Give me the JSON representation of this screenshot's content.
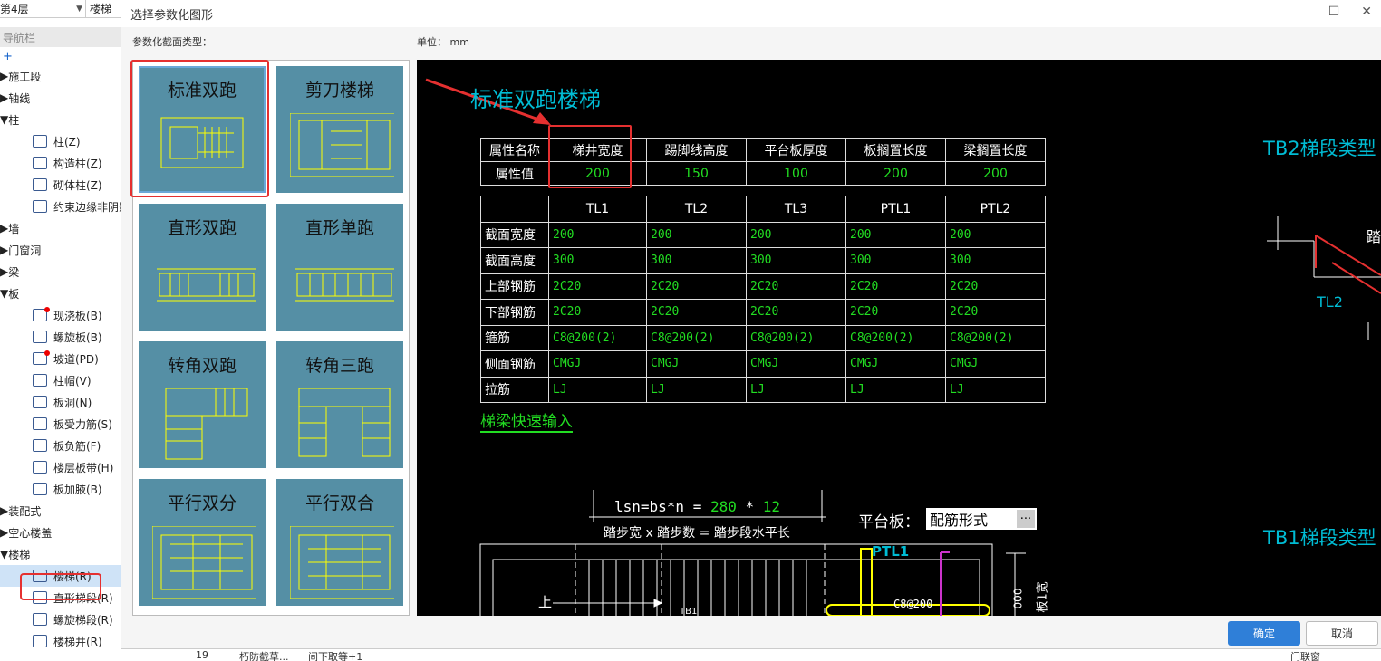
{
  "left_nav": {
    "floor_select": "第4层",
    "type_select": "楼梯",
    "nav_title": "导航栏",
    "add_symbol": "+",
    "items": [
      {
        "label": "施工段",
        "kind": "group",
        "icon": "caret-right"
      },
      {
        "label": "轴线",
        "kind": "group",
        "icon": "caret-right"
      },
      {
        "label": "柱",
        "kind": "group",
        "icon": "caret-down"
      },
      {
        "label": "柱(Z)",
        "kind": "sub",
        "icon": "column-icon"
      },
      {
        "label": "构造柱(Z)",
        "kind": "sub",
        "icon": "constructional-column-icon"
      },
      {
        "label": "砌体柱(Z)",
        "kind": "sub",
        "icon": "masonry-column-icon"
      },
      {
        "label": "约束边缘非阴影",
        "kind": "sub",
        "icon": "edge-column-icon"
      },
      {
        "label": "墙",
        "kind": "group",
        "icon": "caret-right"
      },
      {
        "label": "门窗洞",
        "kind": "group",
        "icon": "caret-right"
      },
      {
        "label": "梁",
        "kind": "group",
        "icon": "caret-right"
      },
      {
        "label": "板",
        "kind": "group",
        "icon": "caret-down"
      },
      {
        "label": "现浇板(B)",
        "kind": "sub",
        "icon": "cast-slab-icon",
        "dot": true
      },
      {
        "label": "螺旋板(B)",
        "kind": "sub",
        "icon": "spiral-slab-icon"
      },
      {
        "label": "坡道(PD)",
        "kind": "sub",
        "icon": "ramp-icon",
        "dot": true
      },
      {
        "label": "柱帽(V)",
        "kind": "sub",
        "icon": "column-cap-icon"
      },
      {
        "label": "板洞(N)",
        "kind": "sub",
        "icon": "slab-hole-icon"
      },
      {
        "label": "板受力筋(S)",
        "kind": "sub",
        "icon": "slab-rebar-icon"
      },
      {
        "label": "板负筋(F)",
        "kind": "sub",
        "icon": "negative-rebar-icon"
      },
      {
        "label": "楼层板带(H)",
        "kind": "sub",
        "icon": "slab-strip-icon"
      },
      {
        "label": "板加腋(B)",
        "kind": "sub",
        "icon": "haunch-icon"
      },
      {
        "label": "装配式",
        "kind": "group",
        "icon": "caret-right"
      },
      {
        "label": "空心楼盖",
        "kind": "group",
        "icon": "caret-right"
      },
      {
        "label": "楼梯",
        "kind": "group",
        "icon": "caret-down"
      },
      {
        "label": "楼梯(R)",
        "kind": "sub",
        "icon": "stair-icon",
        "selected": true
      },
      {
        "label": "直形梯段(R)",
        "kind": "sub",
        "icon": "straight-flight-icon"
      },
      {
        "label": "螺旋梯段(R)",
        "kind": "sub",
        "icon": "spiral-flight-icon"
      },
      {
        "label": "楼梯井(R)",
        "kind": "sub",
        "icon": "stairwell-icon"
      }
    ]
  },
  "dialog": {
    "title": "选择参数化图形",
    "section_label": "参数化截面类型：",
    "unit_label": "单位：",
    "unit_value": "mm",
    "ok_label": "确定",
    "cancel_label": "取消",
    "max_symbol": "☐",
    "close_symbol": "✕",
    "thumbnails": [
      {
        "name": "标准双跑",
        "selected": true
      },
      {
        "name": "剪刀楼梯"
      },
      {
        "name": "直形双跑"
      },
      {
        "name": "直形单跑"
      },
      {
        "name": "转角双跑"
      },
      {
        "name": "转角三跑"
      },
      {
        "name": "平行双分"
      },
      {
        "name": "平行双合"
      }
    ]
  },
  "cad": {
    "title": "标准双跑楼梯",
    "attr_table": {
      "headers": [
        "属性名称",
        "梯井宽度",
        "踢脚线高度",
        "平台板厚度",
        "板搁置长度",
        "梁搁置长度"
      ],
      "row_label": "属性值",
      "values": [
        "200",
        "150",
        "100",
        "200",
        "200"
      ]
    },
    "beam_table": {
      "columns": [
        "TL1",
        "TL2",
        "TL3",
        "PTL1",
        "PTL2"
      ],
      "rows": [
        {
          "label": "截面宽度",
          "values": [
            "200",
            "200",
            "200",
            "200",
            "200"
          ]
        },
        {
          "label": "截面高度",
          "values": [
            "300",
            "300",
            "300",
            "300",
            "300"
          ]
        },
        {
          "label": "上部钢筋",
          "values": [
            "2C20",
            "2C20",
            "2C20",
            "2C20",
            "2C20"
          ]
        },
        {
          "label": "下部钢筋",
          "values": [
            "2C20",
            "2C20",
            "2C20",
            "2C20",
            "2C20"
          ]
        },
        {
          "label": "箍筋",
          "values": [
            "C8@200(2)",
            "C8@200(2)",
            "C8@200(2)",
            "C8@200(2)",
            "C8@200(2)"
          ]
        },
        {
          "label": "侧面钢筋",
          "values": [
            "CMGJ",
            "CMGJ",
            "CMGJ",
            "CMGJ",
            "CMGJ"
          ]
        },
        {
          "label": "拉筋",
          "values": [
            "LJ",
            "LJ",
            "LJ",
            "LJ",
            "LJ"
          ]
        }
      ]
    },
    "quick_input_link": "梯梁快速输入",
    "formula_prefix": "lsn=bs*n = ",
    "formula_bs": "280",
    "formula_mult": " * ",
    "formula_n": "12",
    "formula_desc": "踏步宽 x 踏步数 = 踏步段水平长",
    "platform_label": "平台板：",
    "platform_value": "配筋形式",
    "more_symbol": "···",
    "tb2_label": "TB2梯段类型",
    "tb1_label": "TB1梯段类型",
    "tl2_label": "TL2",
    "tb2_side_text": "踏",
    "ptl1_label": "PTL1",
    "stirrup_label": "C8@200",
    "up_label": "上",
    "tb1_small": "TB1",
    "dim_text": "000",
    "side_text": "板1宽"
  },
  "bg_strip": {
    "row_num": "19",
    "col1": "朽防截草...",
    "col2": "间下取等+1",
    "col3": "门联窗"
  }
}
